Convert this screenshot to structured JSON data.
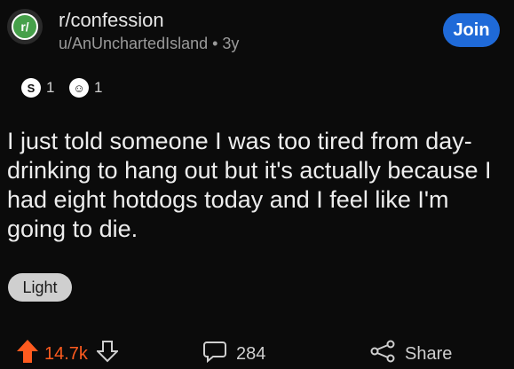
{
  "header": {
    "subreddit_icon_text": "r/",
    "subreddit": "r/confession",
    "meta": "u/AnUnchartedIsland • 3y",
    "join_label": "Join"
  },
  "awards": [
    {
      "icon": "silver-award-icon",
      "count": "1"
    },
    {
      "icon": "wholesome-award-icon",
      "count": "1"
    }
  ],
  "post": {
    "body": "I just told someone I was too tired from day-drinking to hang out but it's actually because I had eight hotdogs today and I feel like I'm going to die.",
    "flair": "Light"
  },
  "actions": {
    "upvotes": "14.7k",
    "comments": "284",
    "share_label": "Share"
  },
  "colors": {
    "background": "#0b0b0b",
    "join": "#1f6ad8",
    "upvote": "#ff5b1f",
    "subreddit_icon": "#46a04a"
  }
}
